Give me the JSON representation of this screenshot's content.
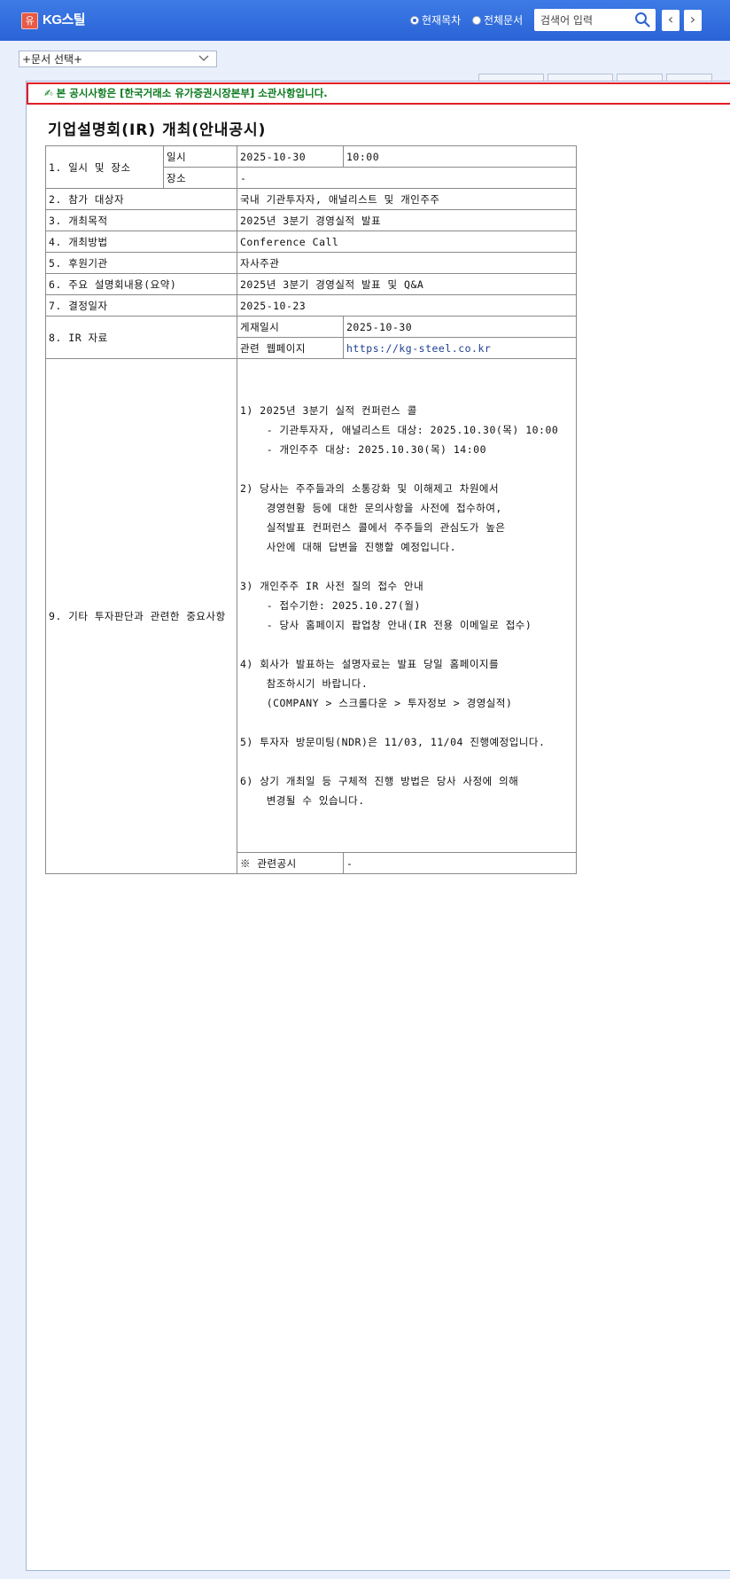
{
  "header": {
    "logo_glyph": "유",
    "company": "KG스틸",
    "radio_current": "현재목차",
    "radio_all": "전체문서",
    "search_placeholder": "검색어 입력",
    "prev": "‹",
    "next": "›"
  },
  "doc_select": {
    "value": "+문서 선택+"
  },
  "notice": {
    "icon": "✍",
    "prefix": "본 공시사항은 ",
    "org": "[한국거래소 유가증권시장본부]",
    "suffix": " 소관사항입니다."
  },
  "title": "기업설명회(IR) 개최(안내공시)",
  "table": {
    "r1_label": "1. 일시 및 장소",
    "r1_sub1": "일시",
    "r1_date": "2025-10-30",
    "r1_time": "10:00",
    "r1_sub2": "장소",
    "r1_place": "-",
    "r2_label": "2. 참가 대상자",
    "r2_value": "국내 기관투자자, 애널리스트 및 개인주주",
    "r3_label": "3. 개최목적",
    "r3_value": "2025년 3분기 경영실적 발표",
    "r4_label": "4. 개최방법",
    "r4_value": "Conference Call",
    "r5_label": "5. 후원기관",
    "r5_value": "자사주관",
    "r6_label": "6. 주요 설명회내용(요약)",
    "r6_value": "2025년 3분기 경영실적 발표 및 Q&A",
    "r7_label": "7. 결정일자",
    "r7_value": "2025-10-23",
    "r8_label": "8. IR 자료",
    "r8_sub1": "게재일시",
    "r8_date": "2025-10-30",
    "r8_sub2": "관련 웹페이지",
    "r8_url": "https://kg-steel.co.kr",
    "r9_label": "9. 기타 투자판단과 관련한 중요사항",
    "r9_lines": [
      "1) 2025년 3분기 실적 컨퍼런스 콜",
      "    - 기관투자자, 애널리스트 대상: 2025.10.30(목) 10:00",
      "    - 개인주주 대상: 2025.10.30(목) 14:00",
      "",
      "2) 당사는 주주들과의 소통강화 및 이해제고 차원에서",
      "    경영현황 등에 대한 문의사항을 사전에 접수하여,",
      "    실적발표 컨퍼런스 콜에서 주주들의 관심도가 높은",
      "    사안에 대해 답변을 진행할 예정입니다.",
      "",
      "3) 개인주주 IR 사전 질의 접수 안내",
      "    - 접수기한: 2025.10.27(월)",
      "    - 당사 홈페이지 팝업창 안내(IR 전용 이메일로 접수)",
      "",
      "4) 회사가 발표하는 설명자료는 발표 당일 홈페이지를",
      "    참조하시기 바랍니다.",
      "    (COMPANY > 스크롤다운 > 투자정보 > 경영실적)",
      "",
      "5) 투자자 방문미팅(NDR)은 11/03, 11/04 진행예정입니다.",
      "",
      "6) 상기 개최일 등 구체적 진행 방법은 당사 사정에 의해",
      "    변경될 수 있습니다."
    ],
    "r10_label": "※ 관련공시",
    "r10_value": "-"
  }
}
